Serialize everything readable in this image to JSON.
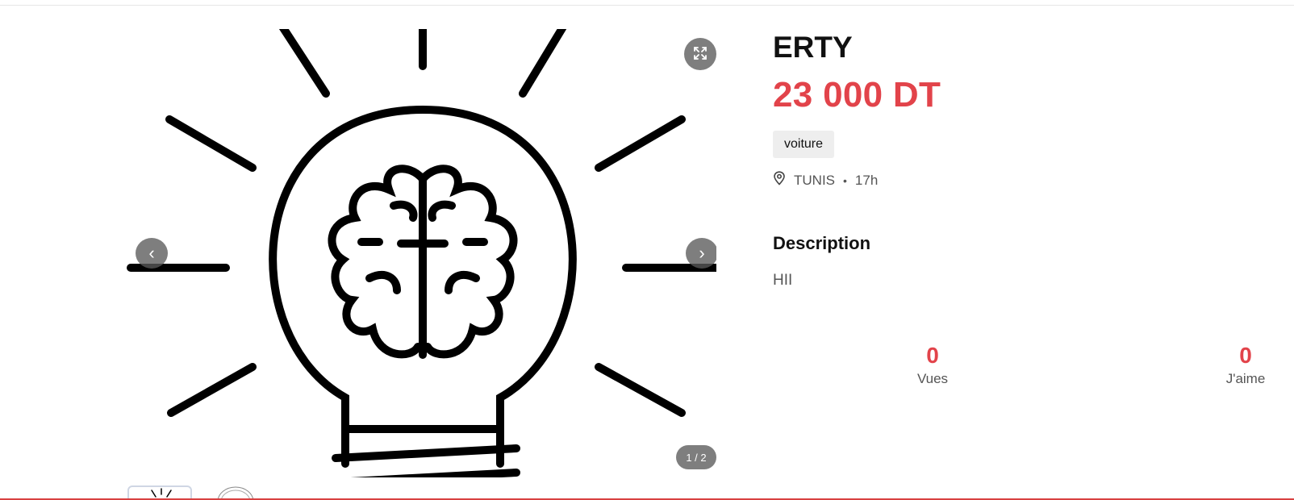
{
  "listing": {
    "title": "ERTY",
    "price": "23 000 DT",
    "category_tag": "voiture",
    "location": "TUNIS",
    "separator": "•",
    "posted_ago": "17h",
    "description_heading": "Description",
    "description": "HII"
  },
  "gallery": {
    "counter": "1 / 2",
    "prev_symbol": "‹",
    "next_symbol": "›",
    "icons": {
      "expand": "expand-icon",
      "prev": "chevron-left-icon",
      "next": "chevron-right-icon",
      "location": "location-pin-icon"
    }
  },
  "stats": {
    "views_value": "0",
    "views_label": "Vues",
    "likes_value": "0",
    "likes_label": "J'aime"
  },
  "colors": {
    "accent": "#e2434a",
    "tag_bg": "#eeeeee",
    "overlay_button": "#5a5a5a"
  }
}
